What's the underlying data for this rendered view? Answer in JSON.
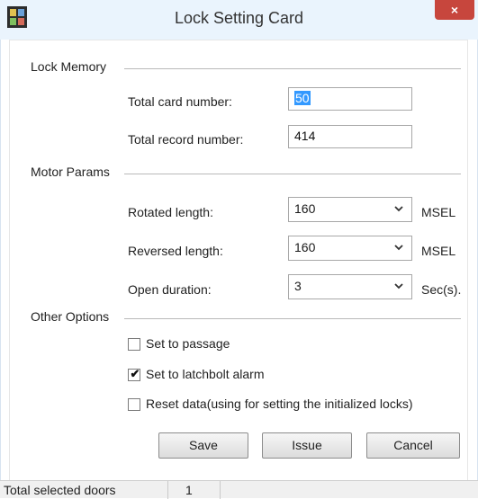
{
  "window": {
    "title": "Lock Setting Card",
    "close_glyph": "×",
    "app_icon": "app-icon"
  },
  "sections": {
    "lock_memory": "Lock Memory",
    "motor_params": "Motor Params",
    "other_options": "Other Options"
  },
  "lock_memory": {
    "total_card_label": "Total card number:",
    "total_card_value": "50",
    "total_record_label": "Total record number:",
    "total_record_value": "414"
  },
  "motor_params": {
    "rotated_label": "Rotated length:",
    "rotated_value": "160",
    "rotated_unit": "MSEL",
    "reversed_label": "Reversed length:",
    "reversed_value": "160",
    "reversed_unit": "MSEL",
    "open_label": "Open duration:",
    "open_value": "3",
    "open_unit": "Sec(s)."
  },
  "options": [
    {
      "label": "Set to passage",
      "checked": false
    },
    {
      "label": "Set to latchbolt alarm",
      "checked": true
    },
    {
      "label": "Reset data(using for setting the initialized locks)",
      "checked": false
    }
  ],
  "buttons": {
    "save": "Save",
    "issue": "Issue",
    "cancel": "Cancel"
  },
  "status": {
    "label": "Total selected doors",
    "value": "1"
  },
  "colors": {
    "titlebar": "#eaf4fd",
    "close": "#c7463d",
    "selection": "#3399ff"
  }
}
